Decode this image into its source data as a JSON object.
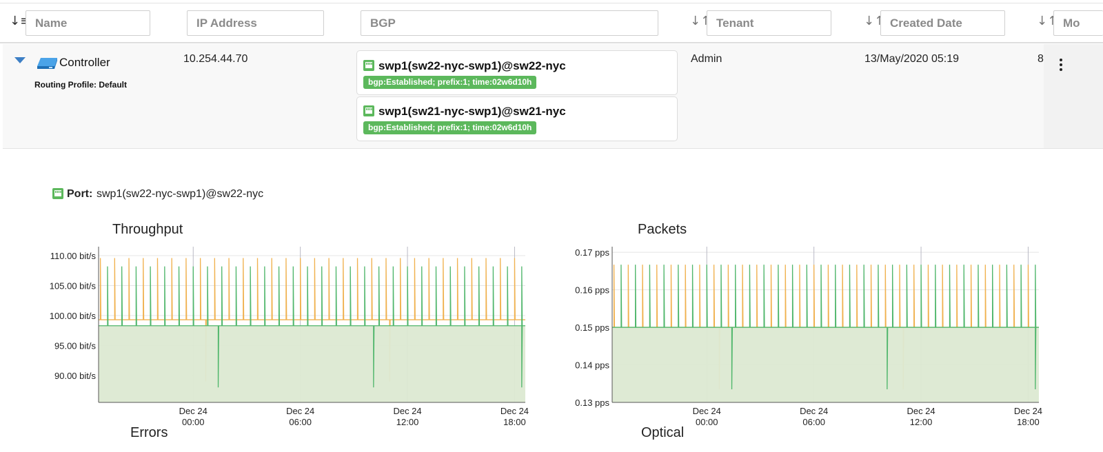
{
  "table": {
    "headers": {
      "name": "Name",
      "ip_address": "IP Address",
      "bgp": "BGP",
      "tenant": "Tenant",
      "created_date": "Created Date",
      "model_truncated": "Mo"
    },
    "row": {
      "device_name": "Controller",
      "routing_profile": "Routing Profile: Default",
      "ip_address": "10.254.44.70",
      "tenant": "Admin",
      "created_date": "13/May/2020 05:19",
      "next_col_truncated": "8",
      "bgp_sessions": [
        {
          "port": "swp1(sw22-nyc-swp1)@sw22-nyc",
          "status": "bgp:Established; prefix:1; time:02w6d10h"
        },
        {
          "port": "swp1(sw21-nyc-swp1)@sw21-nyc",
          "status": "bgp:Established; prefix:1; time:02w6d10h"
        }
      ]
    }
  },
  "detail": {
    "port_label": "Port:",
    "port_value": "swp1(sw22-nyc-swp1)@sw22-nyc",
    "more_titles": {
      "errors": "Errors",
      "optical": "Optical"
    }
  },
  "colors": {
    "accent_blue": "#3d7fc5",
    "status_green": "#5cb85c",
    "series_orange": "#f0b14e",
    "series_green": "#4fb66b",
    "fill_green": "#dce9d2"
  },
  "chart_data": [
    {
      "type": "area",
      "title": "Throughput",
      "y_ticks": [
        "110.00 bit/s",
        "105.00 bit/s",
        "100.00 bit/s",
        "95.00 bit/s",
        "90.00 bit/s"
      ],
      "y_tick_values": [
        110,
        105,
        100,
        95,
        90
      ],
      "ylim": [
        85.5,
        111.5
      ],
      "x_ticks": [
        {
          "line1": "Dec 24",
          "line2": "00:00"
        },
        {
          "line1": "Dec 24",
          "line2": "06:00"
        },
        {
          "line1": "Dec 24",
          "line2": "12:00"
        },
        {
          "line1": "Dec 24",
          "line2": "18:00"
        }
      ],
      "x_tick_hours": [
        0,
        6,
        12,
        18
      ],
      "xlim_hours": [
        -5.3,
        18.6
      ],
      "grid": true,
      "series": [
        {
          "color": "#f0b14e",
          "baseline": 99.3,
          "spike_high": 109.6,
          "dips": [
            {
              "hour": 0.7,
              "value": 89.0
            },
            {
              "hour": 11.0,
              "value": 89.0
            }
          ]
        },
        {
          "color": "#4fb66b",
          "baseline": 98.3,
          "spike_high": 108.2,
          "fill": "#dce9d2",
          "dips": [
            {
              "hour": 1.4,
              "value": 88.0
            },
            {
              "hour": 10.1,
              "value": 88.0
            },
            {
              "hour": 18.4,
              "value": 88.0
            }
          ]
        }
      ],
      "spike_interval_hours": 0.8
    },
    {
      "type": "area",
      "title": "Packets",
      "y_ticks": [
        "0.17 pps",
        "0.16 pps",
        "0.15 pps",
        "0.14 pps",
        "0.13 pps"
      ],
      "y_tick_values": [
        0.17,
        0.16,
        0.15,
        0.14,
        0.13
      ],
      "ylim": [
        0.13,
        0.1715
      ],
      "x_ticks": [
        {
          "line1": "Dec 24",
          "line2": "00:00"
        },
        {
          "line1": "Dec 24",
          "line2": "06:00"
        },
        {
          "line1": "Dec 24",
          "line2": "12:00"
        },
        {
          "line1": "Dec 24",
          "line2": "18:00"
        }
      ],
      "x_tick_hours": [
        0,
        6,
        12,
        18
      ],
      "xlim_hours": [
        -5.3,
        18.6
      ],
      "grid": true,
      "series": [
        {
          "color": "#f0b14e",
          "baseline": 0.15,
          "spike_high": 0.1667,
          "dips": [
            {
              "hour": 0.7,
              "value": 0.1335
            },
            {
              "hour": 11.0,
              "value": 0.1335
            }
          ]
        },
        {
          "color": "#4fb66b",
          "baseline": 0.15,
          "spike_high": 0.1667,
          "fill": "#dce9d2",
          "dips": [
            {
              "hour": 1.4,
              "value": 0.1335
            },
            {
              "hour": 10.1,
              "value": 0.1335
            },
            {
              "hour": 18.4,
              "value": 0.1335
            }
          ]
        }
      ],
      "spike_interval_hours": 0.8
    }
  ]
}
